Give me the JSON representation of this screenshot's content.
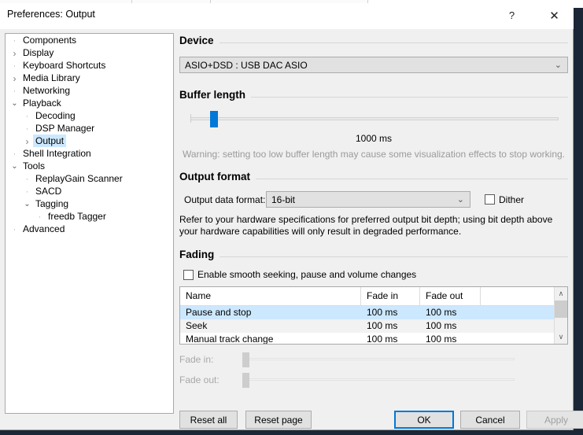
{
  "background_window": {
    "columns": [
      "",
      "",
      ""
    ]
  },
  "dialog": {
    "title": "Preferences: Output",
    "help_icon": "?",
    "close_icon": "✕"
  },
  "tree": {
    "items": [
      {
        "label": "Components",
        "depth": 1,
        "marker": "dots",
        "selected": false
      },
      {
        "label": "Display",
        "depth": 1,
        "marker": "collapsed",
        "selected": false
      },
      {
        "label": "Keyboard Shortcuts",
        "depth": 1,
        "marker": "dots",
        "selected": false
      },
      {
        "label": "Media Library",
        "depth": 1,
        "marker": "collapsed",
        "selected": false
      },
      {
        "label": "Networking",
        "depth": 1,
        "marker": "dots",
        "selected": false
      },
      {
        "label": "Playback",
        "depth": 1,
        "marker": "expanded",
        "selected": false
      },
      {
        "label": "Decoding",
        "depth": 2,
        "marker": "dots",
        "selected": false
      },
      {
        "label": "DSP Manager",
        "depth": 2,
        "marker": "dots",
        "selected": false
      },
      {
        "label": "Output",
        "depth": 2,
        "marker": "collapsed",
        "selected": true
      },
      {
        "label": "Shell Integration",
        "depth": 1,
        "marker": "dots",
        "selected": false
      },
      {
        "label": "Tools",
        "depth": 1,
        "marker": "expanded",
        "selected": false
      },
      {
        "label": "ReplayGain Scanner",
        "depth": 2,
        "marker": "dots",
        "selected": false
      },
      {
        "label": "SACD",
        "depth": 2,
        "marker": "dots",
        "selected": false
      },
      {
        "label": "Tagging",
        "depth": 2,
        "marker": "expanded",
        "selected": false
      },
      {
        "label": "freedb Tagger",
        "depth": 3,
        "marker": "dots",
        "selected": false
      },
      {
        "label": "Advanced",
        "depth": 1,
        "marker": "dots",
        "selected": false
      }
    ]
  },
  "device": {
    "group_title": "Device",
    "selected": "ASIO+DSD : USB DAC ASIO",
    "arrow": "⌄"
  },
  "buffer": {
    "group_title": "Buffer length",
    "value_label": "1000 ms",
    "warning": "Warning: setting too low buffer length may cause some visualization effects to stop working.",
    "thumb_percent": 5,
    "accent_color": "#0078d7"
  },
  "output_format": {
    "group_title": "Output format",
    "field_label": "Output data format:",
    "selected": "16-bit",
    "arrow": "⌄",
    "dither_label": "Dither",
    "dither_checked": false,
    "note": "Refer to your hardware specifications for preferred output bit depth; using bit depth above your hardware capabilities will only result in degraded performance."
  },
  "fading": {
    "group_title": "Fading",
    "enable_label": "Enable smooth seeking, pause and volume changes",
    "enable_checked": false,
    "table": {
      "headers": [
        "Name",
        "Fade in",
        "Fade out",
        ""
      ],
      "rows": [
        {
          "name": "Pause and stop",
          "fade_in": "100 ms",
          "fade_out": "100 ms",
          "selected": true
        },
        {
          "name": "Seek",
          "fade_in": "100 ms",
          "fade_out": "100 ms",
          "selected": false
        },
        {
          "name": "Manual track change",
          "fade_in": "100 ms",
          "fade_out": "100 ms",
          "selected": false
        }
      ],
      "scroll_up_icon": "∧",
      "scroll_down_icon": "∨"
    },
    "fade_in_label": "Fade in:",
    "fade_out_label": "Fade out:"
  },
  "buttons": {
    "reset_all": "Reset all",
    "reset_page": "Reset page",
    "ok": "OK",
    "cancel": "Cancel",
    "apply": "Apply",
    "apply_disabled": true
  }
}
